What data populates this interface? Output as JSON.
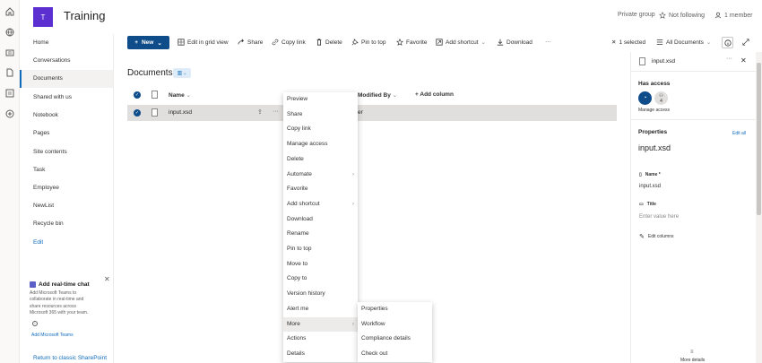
{
  "site": {
    "logo_letter": "T",
    "title": "Training"
  },
  "header": {
    "group_type": "Private group",
    "follow": "Not following",
    "members": "1 member"
  },
  "nav": {
    "items": [
      "Home",
      "Conversations",
      "Documents",
      "Shared with us",
      "Notebook",
      "Pages",
      "Site contents",
      "Task",
      "Employee",
      "NewList",
      "Recycle bin",
      "Edit"
    ],
    "active": "Documents"
  },
  "chat_promo": {
    "title": "Add real-time chat",
    "description": "Add Microsoft Teams to collaborate in real-time and share resources across Microsoft 365 with your team.",
    "link": "Add Microsoft Teams"
  },
  "return_link": "Return to classic SharePoint",
  "commandbar": {
    "new": "New",
    "edit_grid": "Edit in grid view",
    "share": "Share",
    "copy_link": "Copy link",
    "delete": "Delete",
    "pin": "Pin to top",
    "favorite": "Favorite",
    "add_shortcut": "Add shortcut",
    "download": "Download",
    "more": "···",
    "selected": "1 selected",
    "view": "All Documents"
  },
  "library": {
    "title": "Documents",
    "columns": {
      "name": "Name",
      "modified_by": "Modified By",
      "add_column": "Add column"
    },
    "rows": [
      {
        "name": "input.xsd",
        "modified_by_partial": "er"
      }
    ]
  },
  "context_menu": {
    "items": [
      "Preview",
      "Share",
      "Copy link",
      "Manage access",
      "Delete",
      "Automate",
      "Favorite",
      "Add shortcut",
      "Download",
      "Rename",
      "Pin to top",
      "Move to",
      "Copy to",
      "Version history",
      "Alert me",
      "More",
      "Actions",
      "Details"
    ],
    "hovered": "More"
  },
  "submenu": {
    "items": [
      "Properties",
      "Workflow",
      "Compliance details",
      "Check out"
    ]
  },
  "details_panel": {
    "file_name": "input.xsd",
    "has_access": "Has access",
    "access_count": "4",
    "manage_access": "Manage access",
    "properties": "Properties",
    "edit_all": "Edit all",
    "prop_title": "input.xsd",
    "name_label": "Name *",
    "name_value": "input.xsd",
    "title_label": "Title",
    "title_placeholder": "Enter value here",
    "edit_columns": "Edit columns",
    "more_details": "More details"
  },
  "colors": {
    "accent": "#0f6cbd",
    "brand": "#5b2fd0",
    "new_button": "#0f4c8a",
    "selected_row": "#e1dfdd"
  }
}
